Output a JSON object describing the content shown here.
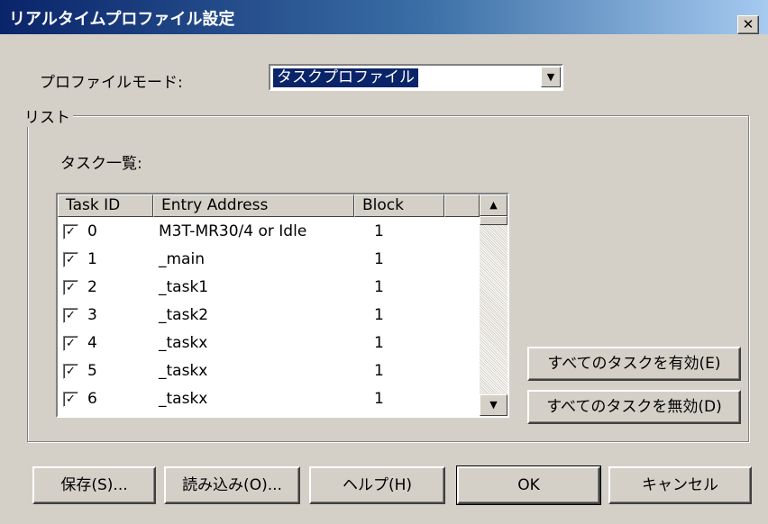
{
  "window": {
    "title": "リアルタイムプロファイル設定",
    "close": "✕"
  },
  "profile_mode": {
    "label": "プロファイルモード:",
    "value": "タスクプロファイル",
    "arrow": "▼"
  },
  "list_group": {
    "label": "リスト"
  },
  "task_list": {
    "label": "タスク一覧:",
    "columns": [
      "Task ID",
      "Entry Address",
      "Block",
      ""
    ],
    "rows": [
      {
        "checked": true,
        "id": "0",
        "entry": "M3T-MR30/4 or Idle",
        "block": "1"
      },
      {
        "checked": true,
        "id": "1",
        "entry": "_main",
        "block": "1"
      },
      {
        "checked": true,
        "id": "2",
        "entry": "_task1",
        "block": "1"
      },
      {
        "checked": true,
        "id": "3",
        "entry": "_task2",
        "block": "1"
      },
      {
        "checked": true,
        "id": "4",
        "entry": "_taskx",
        "block": "1"
      },
      {
        "checked": true,
        "id": "5",
        "entry": "_taskx",
        "block": "1"
      },
      {
        "checked": true,
        "id": "6",
        "entry": "_taskx",
        "block": "1"
      }
    ],
    "scroll_up": "▲",
    "scroll_down": "▼"
  },
  "enable_all_button": "すべてのタスクを有効(E)",
  "disable_all_button": "すべてのタスクを無効(D)",
  "footer": {
    "save": "保存(S)...",
    "load": "読み込み(O)...",
    "help": "ヘルプ(H)",
    "ok": "OK",
    "cancel": "キャンセル"
  }
}
